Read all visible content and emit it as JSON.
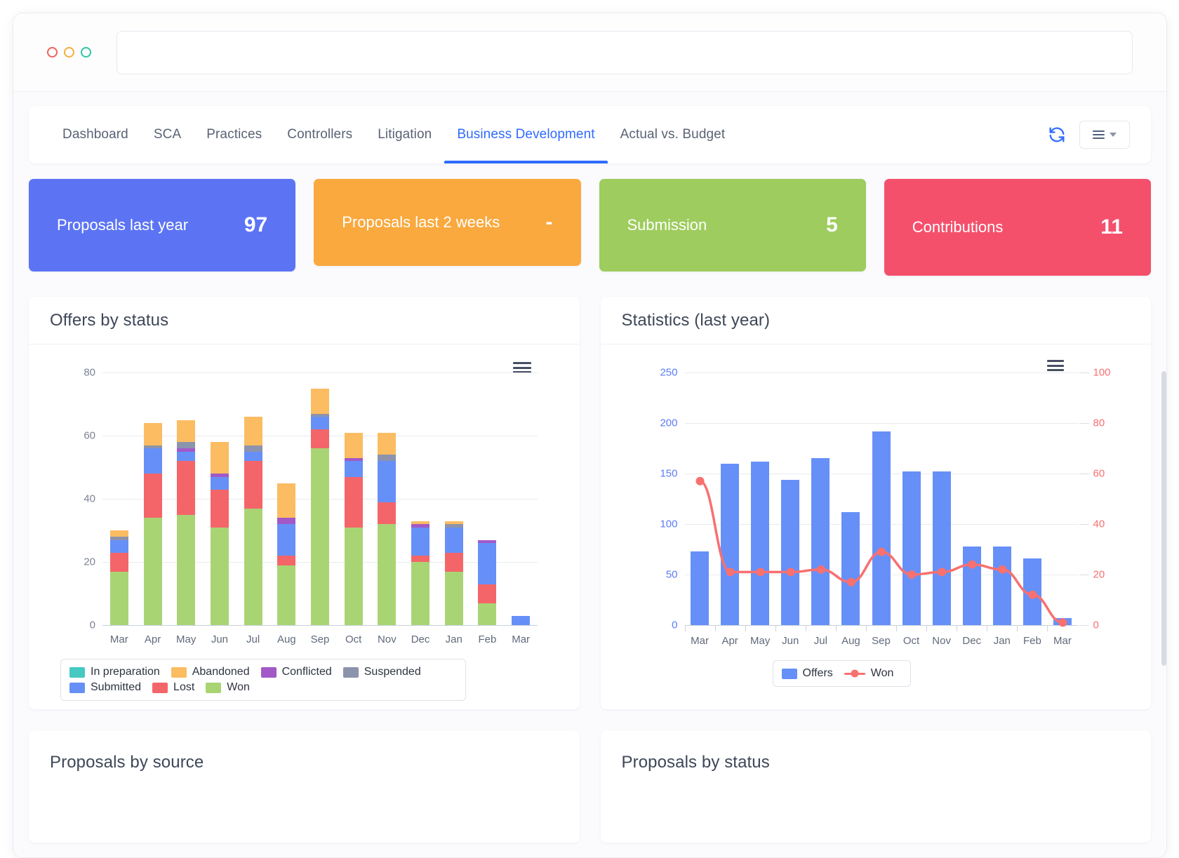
{
  "window": {
    "traffic_lights": [
      "close",
      "minimize",
      "maximize"
    ],
    "url_value": "",
    "url_placeholder": ""
  },
  "nav": {
    "tabs": [
      {
        "label": "Dashboard",
        "active": false
      },
      {
        "label": "SCA",
        "active": false
      },
      {
        "label": "Practices",
        "active": false
      },
      {
        "label": "Controllers",
        "active": false
      },
      {
        "label": "Litigation",
        "active": false
      },
      {
        "label": "Business Development",
        "active": true
      },
      {
        "label": "Actual vs. Budget",
        "active": false
      }
    ],
    "refresh_icon": "refresh-icon",
    "menu_icon": "hamburger-icon",
    "caret_icon": "chevron-down-icon"
  },
  "kpis": [
    {
      "label": "Proposals last year",
      "value": "97",
      "color": "#5c74f4"
    },
    {
      "label": "Proposals last 2 weeks",
      "value": "-",
      "color": "#f9a93e"
    },
    {
      "label": "Submission",
      "value": "5",
      "color": "#9ecc5e"
    },
    {
      "label": "Contributions",
      "value": "11",
      "color": "#f4506c"
    }
  ],
  "panels": {
    "offers_by_status": {
      "title": "Offers by status",
      "menu_icon": "chart-menu-icon"
    },
    "statistics": {
      "title": "Statistics (last year)",
      "menu_icon": "chart-menu-icon"
    },
    "proposals_by_source": {
      "title": "Proposals by source"
    },
    "proposals_by_status": {
      "title": "Proposals by status"
    }
  },
  "chart_data": [
    {
      "type": "bar",
      "stacked": true,
      "title": "Offers by status",
      "xlabel": "",
      "ylabel": "",
      "ylim": [
        0,
        80
      ],
      "yticks": [
        0,
        20,
        40,
        60,
        80
      ],
      "grid": true,
      "legend_position": "bottom",
      "categories": [
        "Mar",
        "Apr",
        "May",
        "Jun",
        "Jul",
        "Aug",
        "Sep",
        "Oct",
        "Nov",
        "Dec",
        "Jan",
        "Feb",
        "Mar"
      ],
      "series": [
        {
          "name": "Won",
          "color": "#a9d474",
          "values": [
            17,
            34,
            35,
            31,
            37,
            19,
            56,
            31,
            32,
            20,
            17,
            7,
            0
          ]
        },
        {
          "name": "Lost",
          "color": "#f4656a",
          "values": [
            6,
            14,
            17,
            12,
            15,
            3,
            6,
            16,
            7,
            2,
            6,
            6,
            0
          ]
        },
        {
          "name": "Submitted",
          "color": "#6690f8",
          "values": [
            4,
            8,
            3,
            4,
            3,
            10,
            4,
            5,
            13,
            9,
            8,
            13,
            3
          ]
        },
        {
          "name": "Conflicted",
          "color": "#a259c7",
          "values": [
            0,
            0,
            1,
            1,
            0,
            2,
            0,
            1,
            0,
            1,
            0,
            1,
            0
          ]
        },
        {
          "name": "Suspended",
          "color": "#8c93ad",
          "values": [
            1,
            1,
            2,
            0,
            2,
            0,
            1,
            0,
            2,
            0,
            1,
            0,
            0
          ]
        },
        {
          "name": "In preparation",
          "color": "#45c9c2",
          "values": [
            0,
            0,
            0,
            0,
            0,
            0,
            0,
            0,
            0,
            0,
            0,
            0,
            0
          ]
        },
        {
          "name": "Abandoned",
          "color": "#fbbc62",
          "values": [
            2,
            7,
            7,
            10,
            9,
            11,
            8,
            8,
            7,
            1,
            1,
            0,
            0
          ]
        }
      ],
      "legend": [
        {
          "label": "In preparation",
          "color": "#45c9c2"
        },
        {
          "label": "Abandoned",
          "color": "#fbbc62"
        },
        {
          "label": "Conflicted",
          "color": "#a259c7"
        },
        {
          "label": "Suspended",
          "color": "#8c93ad"
        },
        {
          "label": "Submitted",
          "color": "#6690f8"
        },
        {
          "label": "Lost",
          "color": "#f4656a"
        },
        {
          "label": "Won",
          "color": "#a9d474"
        }
      ]
    },
    {
      "type": "bar+line",
      "title": "Statistics (last year)",
      "xlabel": "",
      "grid": true,
      "legend_position": "bottom",
      "categories": [
        "Mar",
        "Apr",
        "May",
        "Jun",
        "Jul",
        "Aug",
        "Sep",
        "Oct",
        "Nov",
        "Dec",
        "Jan",
        "Feb",
        "Mar"
      ],
      "left_axis": {
        "label": "Offers",
        "color": "#5b7cf5",
        "ylim": [
          0,
          250
        ],
        "yticks": [
          0,
          50,
          100,
          150,
          200,
          250
        ]
      },
      "right_axis": {
        "label": "Won",
        "color": "#f8706f",
        "ylim": [
          0,
          100
        ],
        "yticks": [
          0,
          20,
          40,
          60,
          80,
          100
        ]
      },
      "series": [
        {
          "name": "Offers",
          "type": "bar",
          "axis": "left",
          "color": "#6690f8",
          "values": [
            73,
            160,
            162,
            144,
            165,
            112,
            192,
            152,
            152,
            78,
            78,
            66,
            7
          ]
        },
        {
          "name": "Won",
          "type": "line",
          "axis": "right",
          "color": "#f8706f",
          "values": [
            57,
            21,
            21,
            21,
            22,
            17,
            29,
            20,
            21,
            24,
            22,
            12,
            1
          ]
        }
      ],
      "legend": [
        {
          "label": "Offers",
          "marker": "square",
          "color": "#6690f8"
        },
        {
          "label": "Won",
          "marker": "line-dot",
          "color": "#f8706f"
        }
      ]
    }
  ]
}
